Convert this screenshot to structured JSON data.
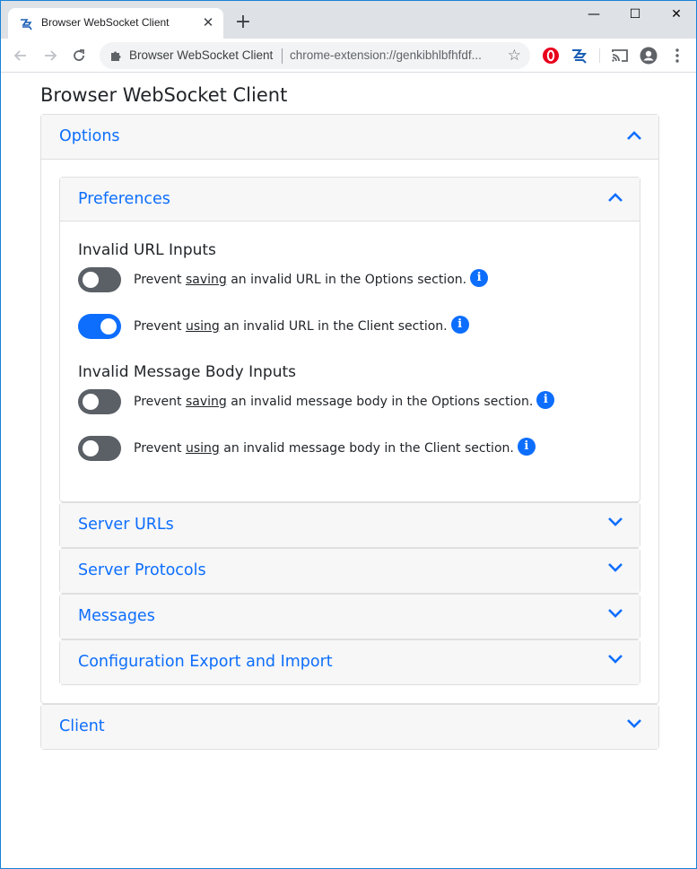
{
  "browser": {
    "tab_title": "Browser WebSocket Client",
    "tab_close": "✕",
    "new_tab": "+",
    "win_minimize": "—",
    "win_maximize": "☐",
    "win_close": "✕",
    "site_name": "Browser WebSocket Client",
    "url": "chrome-extension://genkibhlbfhfdf...",
    "star": "☆"
  },
  "page": {
    "title": "Browser WebSocket Client",
    "options": {
      "label": "Options",
      "preferences": {
        "label": "Preferences",
        "groups": [
          {
            "heading": "Invalid URL Inputs",
            "rows": [
              {
                "pre": "Prevent ",
                "verb": "saving",
                "post": " an invalid URL in the Options section.",
                "on": false
              },
              {
                "pre": "Prevent ",
                "verb": "using",
                "post": " an invalid URL in the Client section.",
                "on": true
              }
            ]
          },
          {
            "heading": "Invalid Message Body Inputs",
            "rows": [
              {
                "pre": "Prevent ",
                "verb": "saving",
                "post": " an invalid message body in the Options section.",
                "on": false
              },
              {
                "pre": "Prevent ",
                "verb": "using",
                "post": " an invalid message body in the Client section.",
                "on": false
              }
            ]
          }
        ]
      },
      "sections": [
        {
          "label": "Server URLs"
        },
        {
          "label": "Server Protocols"
        },
        {
          "label": "Messages"
        },
        {
          "label": "Configuration Export and Import"
        }
      ]
    },
    "client": {
      "label": "Client"
    },
    "info_glyph": "i"
  },
  "colors": {
    "accent": "#0d6efd",
    "switch_off": "#5b6067",
    "header_bg": "#f7f7f7",
    "window_border": "#1883d7"
  }
}
